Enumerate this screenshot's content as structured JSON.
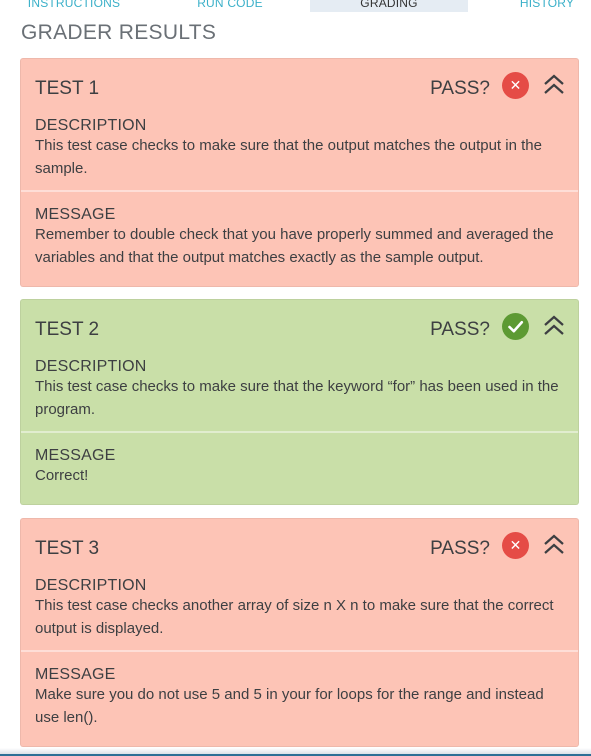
{
  "tabs": [
    {
      "label": "INSTRUCTIONS",
      "active": false
    },
    {
      "label": "RUN CODE",
      "active": false
    },
    {
      "label": "GRADING",
      "active": true
    },
    {
      "label": "HISTORY",
      "active": false
    }
  ],
  "grader": {
    "title": "GRADER RESULTS",
    "tests": [
      {
        "name": "TEST 1",
        "pass_label": "PASS?",
        "status": "fail",
        "status_icon": "x-circle-icon",
        "description_label": "DESCRIPTION",
        "description": "This test case checks to make sure that the output matches the output in the sample.",
        "message_label": "MESSAGE",
        "message": "Remember to double check that you have properly summed and averaged the variables and that the output matches exactly as the sample output."
      },
      {
        "name": "TEST 2",
        "pass_label": "PASS?",
        "status": "pass",
        "status_icon": "check-circle-icon",
        "description_label": "DESCRIPTION",
        "description": "This test case checks to make sure that the keyword “for” has been used in the program.",
        "message_label": "MESSAGE",
        "message": "Correct!"
      },
      {
        "name": "TEST 3",
        "pass_label": "PASS?",
        "status": "fail",
        "status_icon": "x-circle-icon",
        "description_label": "DESCRIPTION",
        "description": "This test case checks another array of size n X n to make sure that the correct output is displayed.",
        "message_label": "MESSAGE",
        "message": "Make sure you do not use 5 and 5 in your for loops for the range and instead use len()."
      }
    ]
  },
  "colors": {
    "fail_bg": "#fdc4b6",
    "pass_bg": "#c9dfa8",
    "fail_icon": "#e54c46",
    "pass_icon": "#5d9a33",
    "tab_link": "#3bb0c9"
  }
}
